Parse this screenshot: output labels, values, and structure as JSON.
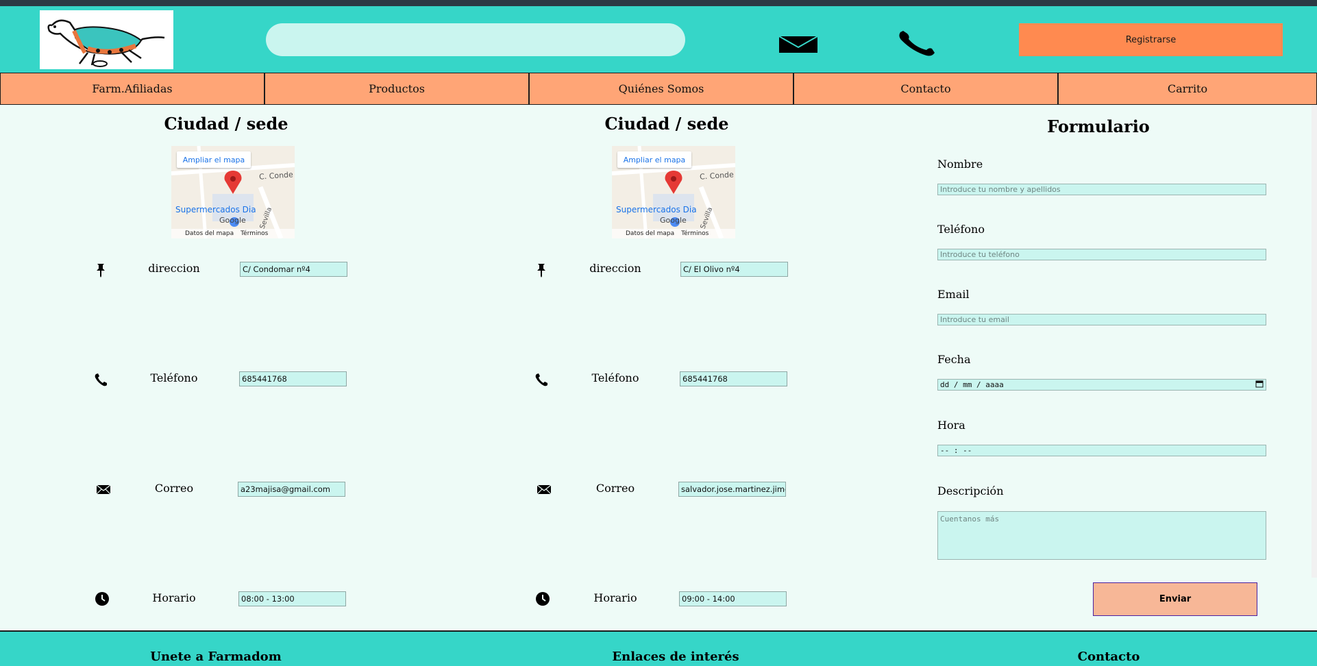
{
  "header": {
    "search_placeholder": "",
    "register_label": "Registrarse",
    "logo_icon": "dog-logo",
    "mail_icon": "envelope-icon",
    "phone_icon": "phone-icon"
  },
  "nav": {
    "items": [
      {
        "label": "Farm.Afiliadas"
      },
      {
        "label": "Productos"
      },
      {
        "label": "Quiénes Somos"
      },
      {
        "label": "Contacto"
      },
      {
        "label": "Carrito"
      }
    ]
  },
  "sedes": [
    {
      "title": "Ciudad / sede",
      "map": {
        "button": "Ampliar el mapa",
        "street": "C. Conde de C",
        "place": "Supermercados Dia",
        "road": "Sevilla",
        "brand": "Google",
        "data_label": "Datos del mapa",
        "terms_label": "Términos"
      },
      "direccion_label": "direccion",
      "direccion": "C/ Condomar nº4",
      "telefono_label": "Teléfono",
      "telefono": "685441768",
      "correo_label": "Correo",
      "correo": "a23majisa@gmail.com",
      "horario_label": "Horario",
      "horario": "08:00 - 13:00"
    },
    {
      "title": "Ciudad / sede",
      "map": {
        "button": "Ampliar el mapa",
        "street": "C. Conde de C",
        "place": "Supermercados Dia",
        "road": "Sevilla",
        "brand": "Google",
        "data_label": "Datos del mapa",
        "terms_label": "Términos"
      },
      "direccion_label": "direccion",
      "direccion": "C/ El Olivo nº4",
      "telefono_label": "Teléfono",
      "telefono": "685441768",
      "correo_label": "Correo",
      "correo": "salvador.jose.martinez.jimen",
      "horario_label": "Horario",
      "horario": "09:00 - 14:00"
    }
  ],
  "form": {
    "title": "Formulario",
    "nombre_label": "Nombre",
    "nombre_placeholder": "Introduce tu nombre y apellidos",
    "telefono_label": "Teléfono",
    "telefono_placeholder": "Introduce tu teléfono",
    "email_label": "Email",
    "email_placeholder": "Introduce tu email",
    "fecha_label": "Fecha",
    "fecha_value": "dd / mm / aaaa",
    "hora_label": "Hora",
    "hora_value": "-- : --",
    "descripcion_label": "Descripción",
    "descripcion_placeholder": "Cuentanos más",
    "submit_label": "Enviar"
  },
  "footer": {
    "col1": "Unete a Farmadom",
    "col2": "Enlaces de interés",
    "col3": "Contacto"
  },
  "colors": {
    "header_bg": "#36d6c8",
    "nav_bg": "#ffa576",
    "register_bg": "#ff8a50",
    "page_bg": "#eefbf7",
    "input_bg": "#caf5ef",
    "submit_bg": "#f7b797"
  }
}
